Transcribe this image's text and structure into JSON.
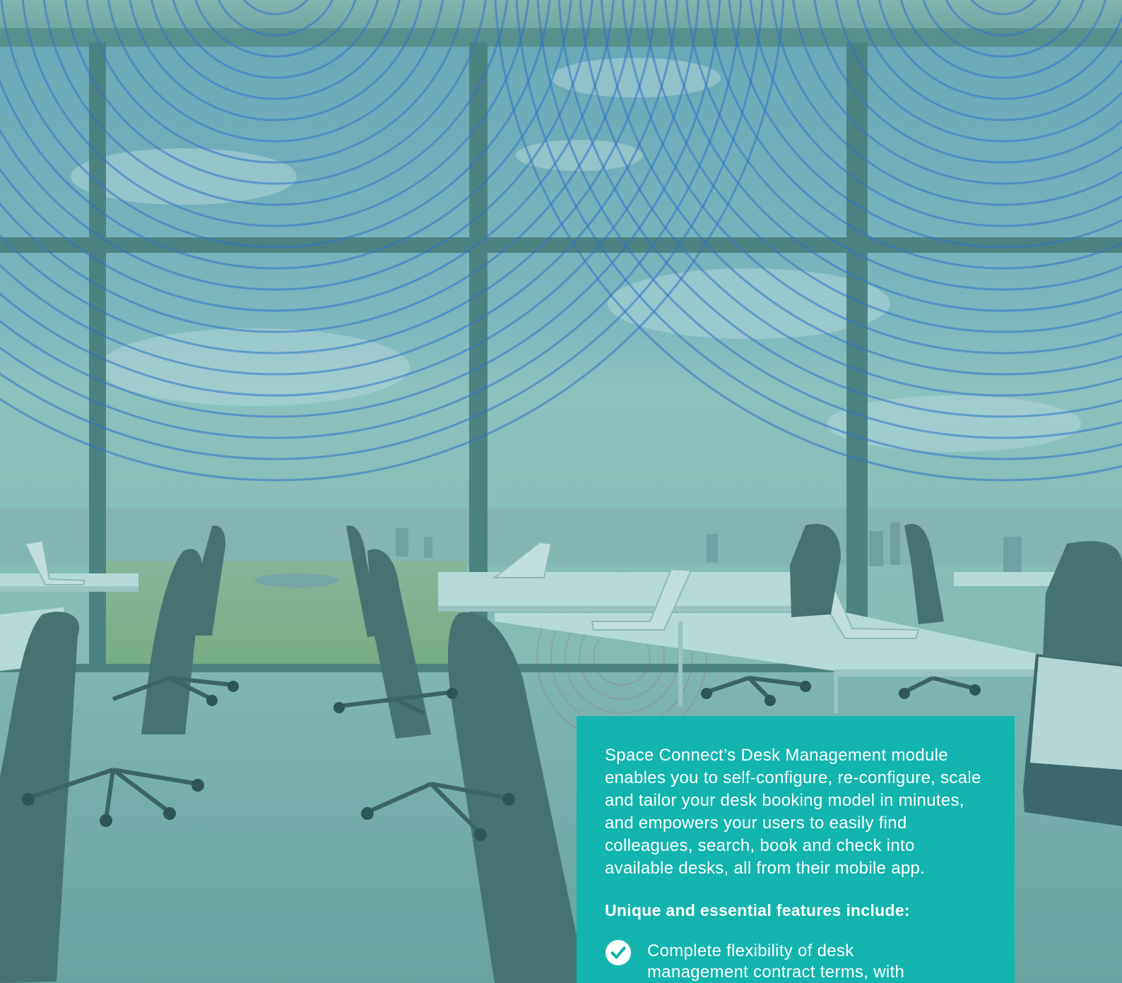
{
  "panel": {
    "intro": "Space Connect’s Desk Management module enables you to self-configure, re-configure, scale and tailor your desk booking model in minutes, and empowers your users to easily find colleagues, search, book and check into available desks, all from their mobile app.",
    "features_heading": "Unique and essential features include:",
    "features": [
      {
        "icon": "check-circle-icon",
        "text": "Complete flexibility of desk management contract terms, with"
      }
    ]
  },
  "colors": {
    "panel_background": "#12b5ae",
    "panel_text": "#ffffff",
    "ripple": "#2f6fd0",
    "photo_tint": "#7fb3b2"
  }
}
